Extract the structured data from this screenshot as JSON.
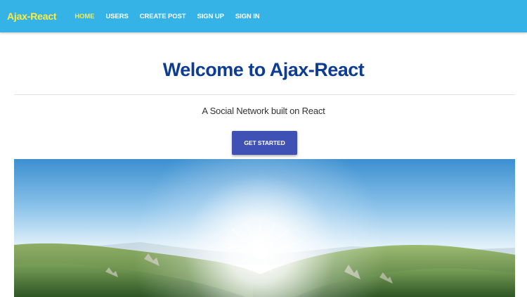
{
  "navbar": {
    "brand": "Ajax-React",
    "items": [
      {
        "label": "HOME",
        "active": true
      },
      {
        "label": "USERS",
        "active": false
      },
      {
        "label": "CREATE POST",
        "active": false
      },
      {
        "label": "SIGN UP",
        "active": false
      },
      {
        "label": "SIGN IN",
        "active": false
      }
    ]
  },
  "main": {
    "title": "Welcome to Ajax-React",
    "tagline": "A Social Network built on React",
    "cta_label": "GET STARTED"
  },
  "colors": {
    "navbar_bg": "#35b3e6",
    "brand": "#ffeb3b",
    "active_nav": "#ffeb3b",
    "title": "#0d3c94",
    "button": "#3f51b5"
  }
}
